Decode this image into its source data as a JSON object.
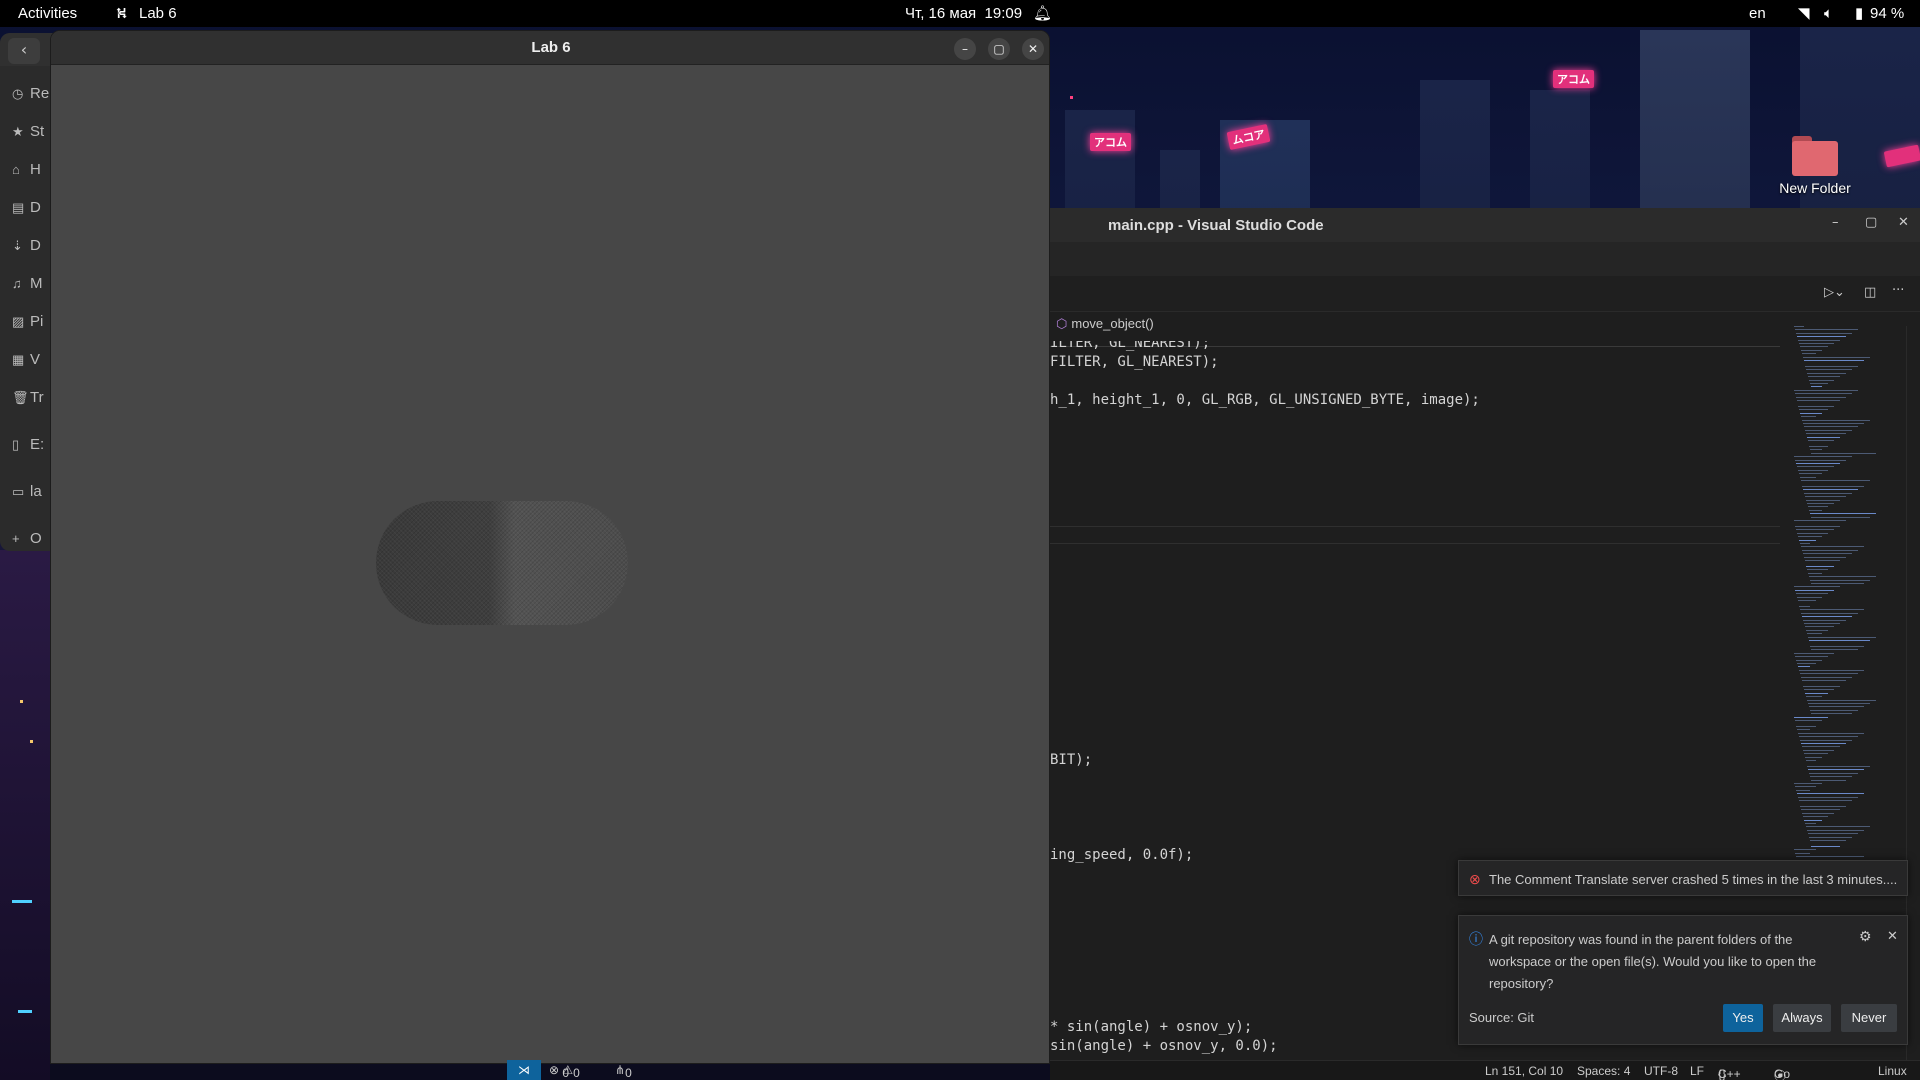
{
  "topbar": {
    "activities": "Activities",
    "app_name": "Lab 6",
    "datetime": "Чт, 16 мая  19:09",
    "language": "en",
    "battery": "94 %"
  },
  "desktop": {
    "folder_label": "New Folder"
  },
  "files_sidebar": {
    "items": [
      "Re",
      "St",
      "H",
      "D",
      "D",
      "M",
      "Pi",
      "V",
      "Tr",
      "E:",
      "la",
      "O"
    ]
  },
  "lab_window": {
    "title": "Lab 6"
  },
  "vscode": {
    "title": "main.cpp - Visual Studio Code",
    "breadcrumb": "move_object()",
    "code_lines": [
      "ILTER, GL_NEAREST);",
      "FILTER, GL_NEAREST);",
      "h_1, height_1, 0, GL_RGB, GL_UNSIGNED_BYTE, image);",
      "BIT);",
      "ing_speed, 0.0f);",
      "* sin(angle) + osnov_y);",
      "sin(angle) + osnov_y, 0.0);"
    ]
  },
  "notifications": {
    "crash_text": "The Comment Translate server crashed 5 times in the last 3 minutes....",
    "git_text": "A git repository was found in the parent folders of the workspace or the open file(s). Would you like to open the repository?",
    "git_source": "Source: Git",
    "yes": "Yes",
    "always": "Always",
    "never": "Never"
  },
  "statusbar": {
    "problems": "0",
    "warnings": "0",
    "ports": "0",
    "position": "Ln 151, Col 10",
    "spaces": "Spaces: 4",
    "encoding": "UTF-8",
    "eol": "LF",
    "language": "C++",
    "golive": "Go Live",
    "platform": "Linux"
  },
  "colors": {
    "accent": "#0e639c",
    "neon": "#e2307b",
    "error": "#f14c4c",
    "info": "#3794ff"
  }
}
